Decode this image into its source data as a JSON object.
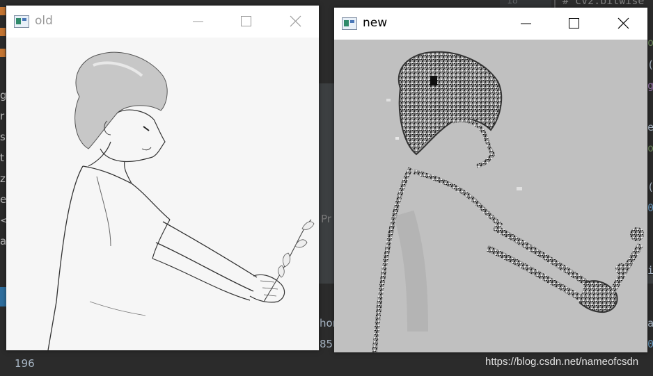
{
  "ide": {
    "line_number": "18",
    "code_text": "# cv2.bitwise",
    "partial_text": "Pr",
    "bottom_texts": [
      "hon",
      "85"
    ],
    "left_chars": [
      "g",
      "r",
      "s",
      "t",
      "z",
      "e",
      "<",
      "a"
    ],
    "right_chars": [
      "o",
      "(",
      "g",
      "e",
      "o",
      "(",
      "0",
      "i",
      "a",
      "0"
    ],
    "status_number": "196"
  },
  "windows": [
    {
      "title": "old",
      "title_color": "#999999",
      "controls": [
        "minimize-icon",
        "maximize-icon",
        "close-icon"
      ]
    },
    {
      "title": "new",
      "title_color": "#000000",
      "controls": [
        "minimize-icon",
        "maximize-icon",
        "close-icon"
      ]
    }
  ],
  "watermark": "https://blog.csdn.net/nameofcsdn"
}
